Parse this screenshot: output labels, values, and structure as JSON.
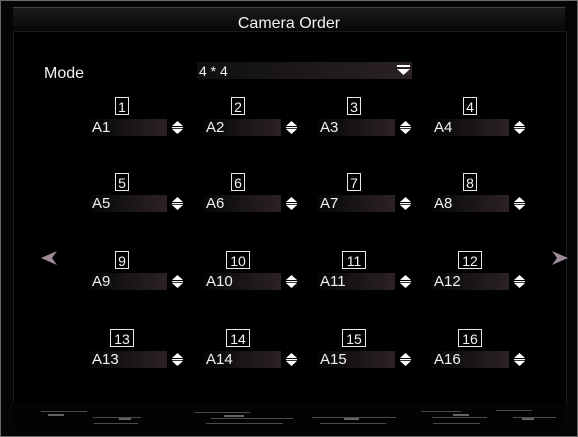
{
  "window": {
    "title": "Camera Order"
  },
  "mode": {
    "label": "Mode",
    "value": "4 * 4"
  },
  "cameras": [
    {
      "position": "1",
      "value": "A1"
    },
    {
      "position": "2",
      "value": "A2"
    },
    {
      "position": "3",
      "value": "A3"
    },
    {
      "position": "4",
      "value": "A4"
    },
    {
      "position": "5",
      "value": "A5"
    },
    {
      "position": "6",
      "value": "A6"
    },
    {
      "position": "7",
      "value": "A7"
    },
    {
      "position": "8",
      "value": "A8"
    },
    {
      "position": "9",
      "value": "A9"
    },
    {
      "position": "10",
      "value": "A10"
    },
    {
      "position": "11",
      "value": "A11"
    },
    {
      "position": "12",
      "value": "A12"
    },
    {
      "position": "13",
      "value": "A13"
    },
    {
      "position": "14",
      "value": "A14"
    },
    {
      "position": "15",
      "value": "A15"
    },
    {
      "position": "16",
      "value": "A16"
    }
  ],
  "icons": {
    "mode_dropdown": "chevron-down-icon",
    "camera_spinner": "up-down-spinner-icon",
    "previous": "arrow-left-icon",
    "next": "arrow-right-icon"
  },
  "colors": {
    "background": "#000000",
    "text": "#f2f2f2",
    "field_gradient_end": "#2c2127",
    "border": "#6a6a6a"
  }
}
